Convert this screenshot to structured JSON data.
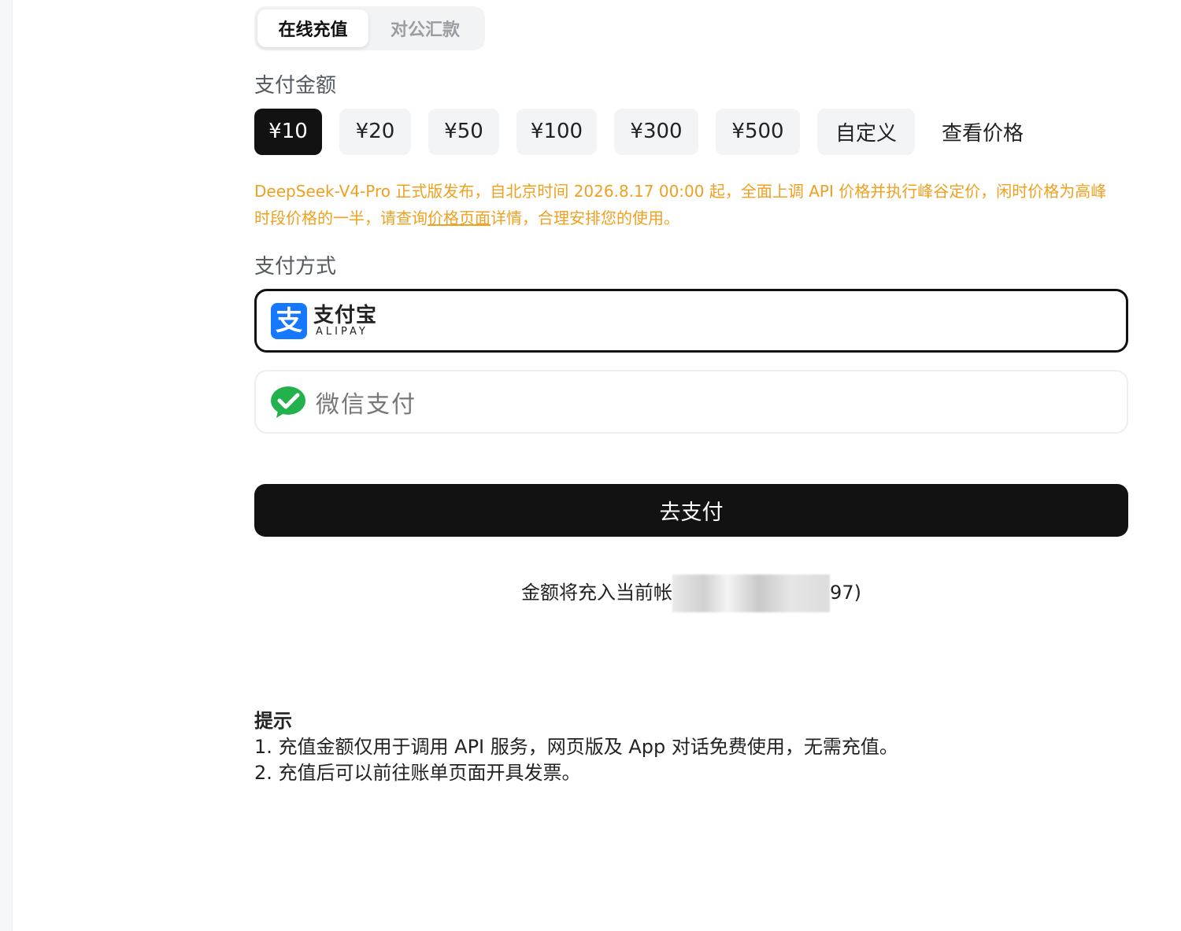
{
  "tabs": [
    {
      "label": "在线充值",
      "active": true
    },
    {
      "label": "对公汇款",
      "active": false
    }
  ],
  "amount_section": {
    "label": "支付金额",
    "options": [
      "¥10",
      "¥20",
      "¥50",
      "¥100",
      "¥300",
      "¥500",
      "自定义"
    ],
    "selected": "¥10",
    "price_link": "查看价格"
  },
  "notice": {
    "text_before": "DeepSeek-V4-Pro 正式版发布，自北京时间 2026.8.17 00:00 起，全面上调 API 价格并执行峰谷定价，闲时价格为高峰时段价格的一半，请查询",
    "link": "价格页面",
    "text_after": "详情，合理安排您的使用。",
    "color": "#f0a020"
  },
  "payment_section": {
    "label": "支付方式",
    "alipay": {
      "logo_char": "支",
      "name": "支付宝",
      "subtitle": "ALIPAY",
      "selected": true,
      "icon": "alipay-icon"
    },
    "wechat": {
      "name": "微信支付",
      "selected": false,
      "icon": "wechat-pay-icon"
    }
  },
  "pay_button": "去支付",
  "account": {
    "prefix": "金额将充入当前帐",
    "suffix": "97)"
  },
  "tips": {
    "title": "提示",
    "items": [
      "1. 充值金额仅用于调用 API 服务，网页版及 App 对话免费使用，无需充值。",
      "2. 充值后可以前往账单页面开具发票。"
    ]
  }
}
